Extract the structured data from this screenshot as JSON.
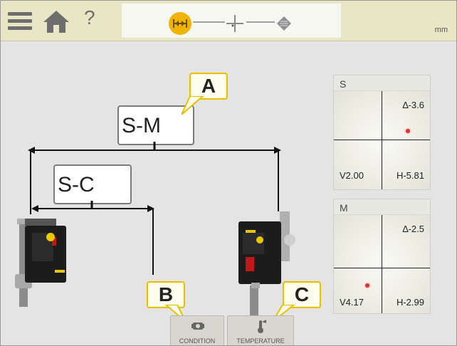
{
  "topbar": {
    "unit_label": "mm",
    "help_label": "?",
    "tabs": [
      {
        "name": "distance-tab",
        "active": true
      },
      {
        "name": "target-tab",
        "active": false
      },
      {
        "name": "tag-tab",
        "active": false
      }
    ]
  },
  "diagram": {
    "callouts": {
      "sm": "S-M",
      "sc": "S-C"
    },
    "badges": {
      "a": "A",
      "b": "B",
      "c": "C"
    }
  },
  "panels": {
    "s": {
      "title": "S",
      "angle": "∆-3.6",
      "v": "V2.00",
      "h": "H-5.81"
    },
    "m": {
      "title": "M",
      "angle": "∆-2.5",
      "v": "V4.17",
      "h": "H-2.99"
    }
  },
  "bottom_buttons": {
    "condition": "CONDITION",
    "temperature": "TEMPERATURE"
  },
  "colors": {
    "accent": "#f0b400",
    "topbar": "#e8e6c4",
    "dot": "#e53030"
  }
}
